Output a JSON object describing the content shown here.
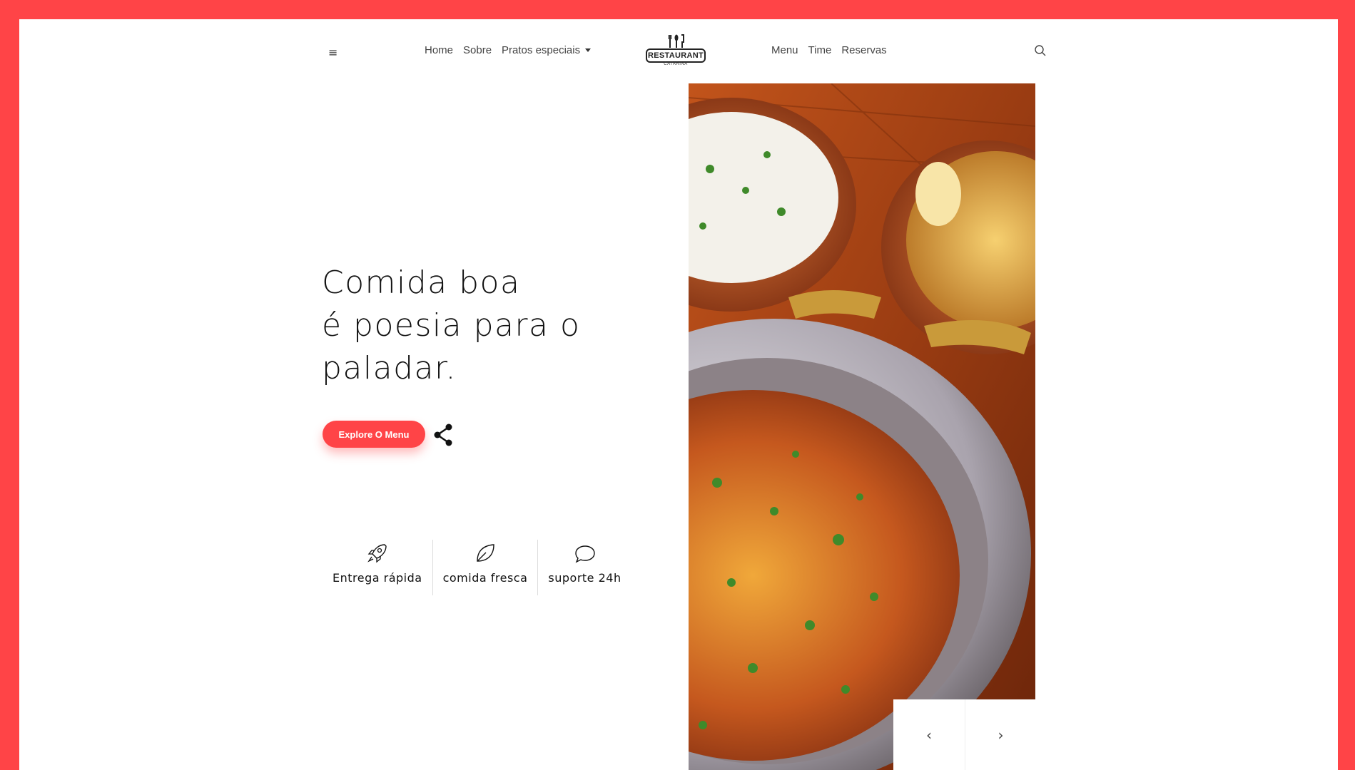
{
  "nav": {
    "menu_toggle": "≡",
    "left_links": [
      "Home",
      "Sobre",
      "Pratos especiais"
    ],
    "right_links": [
      "Menu",
      "Time",
      "Reservas"
    ],
    "logo": {
      "text": "RESTAURANT",
      "subtitle": "CATARINA"
    }
  },
  "hero": {
    "headline_lines": [
      "Comida boa",
      "é poesia para o",
      "paladar."
    ],
    "cta_label": "Explore O Menu",
    "features": [
      {
        "icon": "rocket-icon",
        "label": "Entrega rápida"
      },
      {
        "icon": "leaf-icon",
        "label": "comida fresca"
      },
      {
        "icon": "chat-bubble-icon",
        "label": "suporte 24h"
      }
    ]
  },
  "slider": {
    "prev": "‹",
    "next": "›"
  },
  "colors": {
    "accent": "#ff4447",
    "text": "#111111",
    "background": "#ffffff"
  }
}
